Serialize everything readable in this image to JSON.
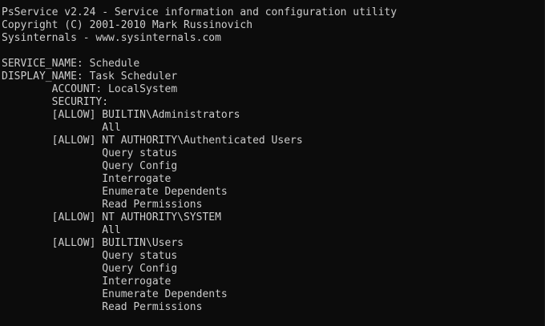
{
  "console": {
    "lines": [
      "PsService v2.24 - Service information and configuration utility",
      "Copyright (C) 2001-2010 Mark Russinovich",
      "Sysinternals - www.sysinternals.com",
      "",
      "SERVICE_NAME: Schedule",
      "DISPLAY_NAME: Task Scheduler",
      "        ACCOUNT: LocalSystem",
      "        SECURITY:",
      "        [ALLOW] BUILTIN\\Administrators",
      "                All",
      "        [ALLOW] NT AUTHORITY\\Authenticated Users",
      "                Query status",
      "                Query Config",
      "                Interrogate",
      "                Enumerate Dependents",
      "                Read Permissions",
      "        [ALLOW] NT AUTHORITY\\SYSTEM",
      "                All",
      "        [ALLOW] BUILTIN\\Users",
      "                Query status",
      "                Query Config",
      "                Interrogate",
      "                Enumerate Dependents",
      "                Read Permissions"
    ]
  },
  "colors": {
    "background": "#0c0c0c",
    "text": "#cccccc"
  }
}
